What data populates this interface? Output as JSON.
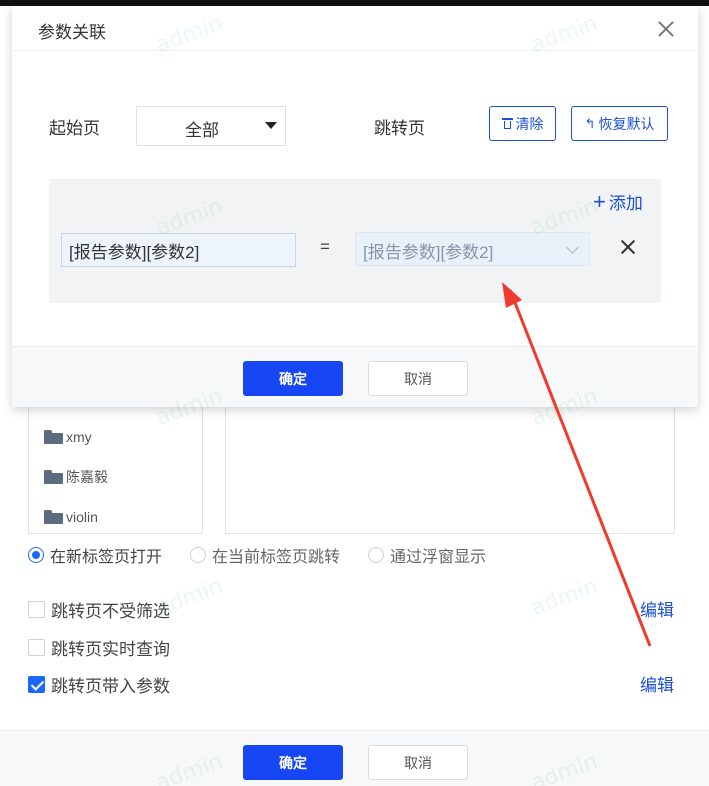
{
  "dialog": {
    "title": "参数关联",
    "start_page_label": "起始页",
    "start_page_value": "全部",
    "jump_page_label": "跳转页",
    "clear_label": "清除",
    "restore_label": "恢复默认",
    "add_label": "添加",
    "param_left": "[报告参数][参数2]",
    "equals": "=",
    "param_right": "[报告参数][参数2]",
    "confirm_label": "确定",
    "cancel_label": "取消"
  },
  "tree": {
    "items": [
      "xmy",
      "陈嘉毅",
      "violin"
    ]
  },
  "open_mode": {
    "options": [
      "在新标签页打开",
      "在当前标签页跳转",
      "通过浮窗显示"
    ],
    "selected": 0
  },
  "options": {
    "not_filtered": "跳转页不受筛选",
    "realtime_query": "跳转页实时查询",
    "with_params": "跳转页带入参数",
    "edit_label": "编辑"
  },
  "footer": {
    "confirm_label": "确定",
    "cancel_label": "取消"
  },
  "watermark": "admin",
  "colors": {
    "primary": "#1747f5",
    "link": "#1a4fd6",
    "arrow": "#f03a2e"
  }
}
